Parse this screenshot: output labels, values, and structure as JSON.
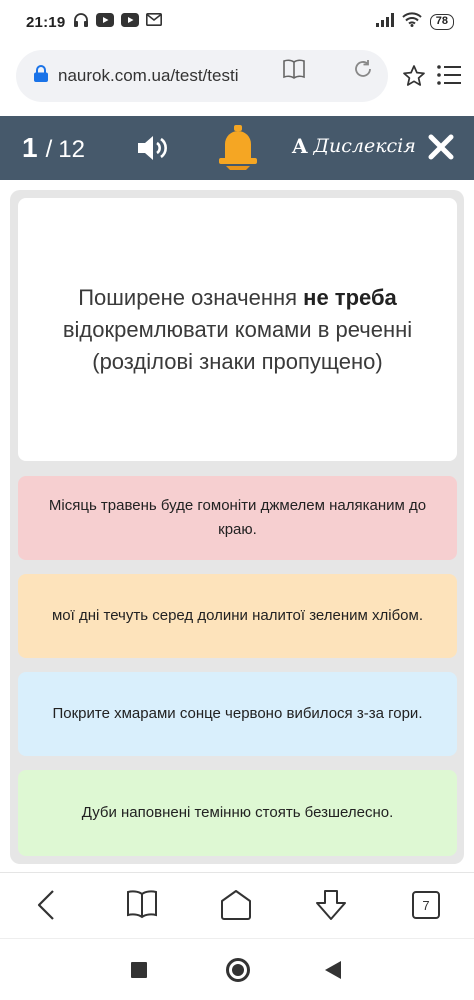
{
  "status_bar": {
    "time": "21:19",
    "battery": "78"
  },
  "browser": {
    "url": "naurok.com.ua/test/testi",
    "tabs_count": "7"
  },
  "quiz_header": {
    "current": "1",
    "separator": "/",
    "total": "12",
    "dyslexia_letter": "A",
    "dyslexia_label": "Дислексія"
  },
  "question": {
    "text_before": "Поширене означення ",
    "text_bold": "не треба",
    "text_after": " відокремлювати комами в реченні (розділові знаки пропущено)"
  },
  "answers": [
    {
      "text": "Місяць травень буде гомоніти джмелем наляканим до краю.",
      "color": "#f6cfd0"
    },
    {
      "text": "мої дні течуть серед долини налитої зеленим хлібом.",
      "color": "#fde3bb"
    },
    {
      "text": "Покрите хмарами сонце червоно вибилося з-за гори.",
      "color": "#d9effc"
    },
    {
      "text": "Дуби наповнені темінню стоять безшелесно.",
      "color": "#def8d3"
    }
  ],
  "colors": {
    "header_bg": "#46596b",
    "bell": "#f5a623",
    "panel_bg": "#e6e6e6"
  },
  "icons": {
    "status": [
      "headphones-icon",
      "youtube-icon",
      "youtube-icon",
      "gmail-icon",
      "signal-icon",
      "wifi-icon",
      "battery-icon"
    ],
    "browser": [
      "lock-icon",
      "reader-icon",
      "reload-icon",
      "star-icon",
      "menu-icon"
    ],
    "quiz": [
      "speaker-icon",
      "bell-icon",
      "close-icon"
    ],
    "nav": [
      "back-icon",
      "bookmarks-icon",
      "home-icon",
      "download-icon",
      "tabs-icon"
    ],
    "android": [
      "recents-icon",
      "home-circle-icon",
      "back-triangle-icon"
    ]
  }
}
